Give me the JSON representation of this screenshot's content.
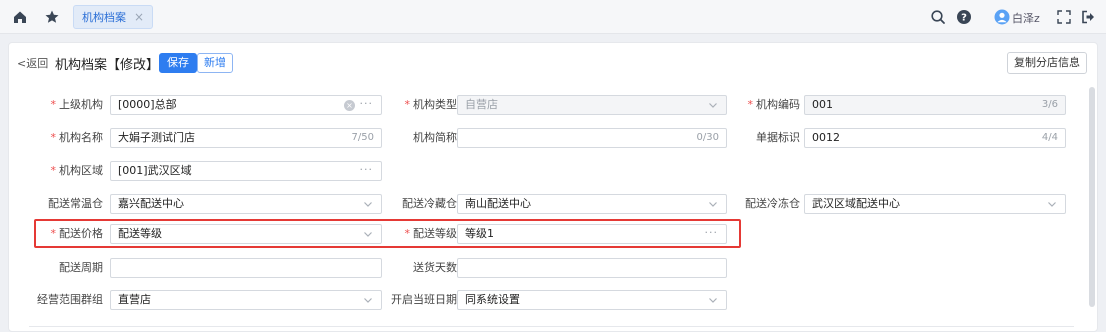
{
  "topbar": {
    "tab_label": "机构档案",
    "tab_close": "×",
    "user_name": "白泽z"
  },
  "header": {
    "back_label": "<返回",
    "title": "机构档案【修改】",
    "save_label": "保存",
    "new_label": "新增",
    "copy_label": "复制分店信息"
  },
  "form": {
    "parent_org": {
      "label": "上级机构",
      "value": "[0000]总部"
    },
    "org_type": {
      "label": "机构类型",
      "value": "自营店"
    },
    "org_code": {
      "label": "机构编码",
      "value": "001",
      "count": "3/6"
    },
    "org_name": {
      "label": "机构名称",
      "value": "大娟子测试门店",
      "count": "7/50"
    },
    "org_short": {
      "label": "机构简称",
      "value": "",
      "count": "0/30"
    },
    "doc_flag": {
      "label": "单据标识",
      "value": "0012",
      "count": "4/4"
    },
    "org_region": {
      "label": "机构区域",
      "value": "[001]武汉区域"
    },
    "dist_normal": {
      "label": "配送常温仓",
      "value": "嘉兴配送中心"
    },
    "dist_cold": {
      "label": "配送冷藏仓",
      "value": "南山配送中心"
    },
    "dist_frozen": {
      "label": "配送冷冻仓",
      "value": "武汉区域配送中心"
    },
    "dist_price": {
      "label": "配送价格",
      "value": "配送等级"
    },
    "dist_level": {
      "label": "配送等级",
      "value": "等级1"
    },
    "dist_cycle": {
      "label": "配送周期",
      "value": ""
    },
    "delivery_days": {
      "label": "送货天数",
      "value": ""
    },
    "scope_group": {
      "label": "经营范围群组",
      "value": "直营店"
    },
    "shift_date": {
      "label": "开启当班日期",
      "value": "同系统设置"
    }
  },
  "glyphs": {
    "dots": "···",
    "clear": "×",
    "required": "*"
  },
  "colors": {
    "accent": "#2e7df0",
    "required": "#ee4d4d",
    "highlight": "#e53935"
  }
}
